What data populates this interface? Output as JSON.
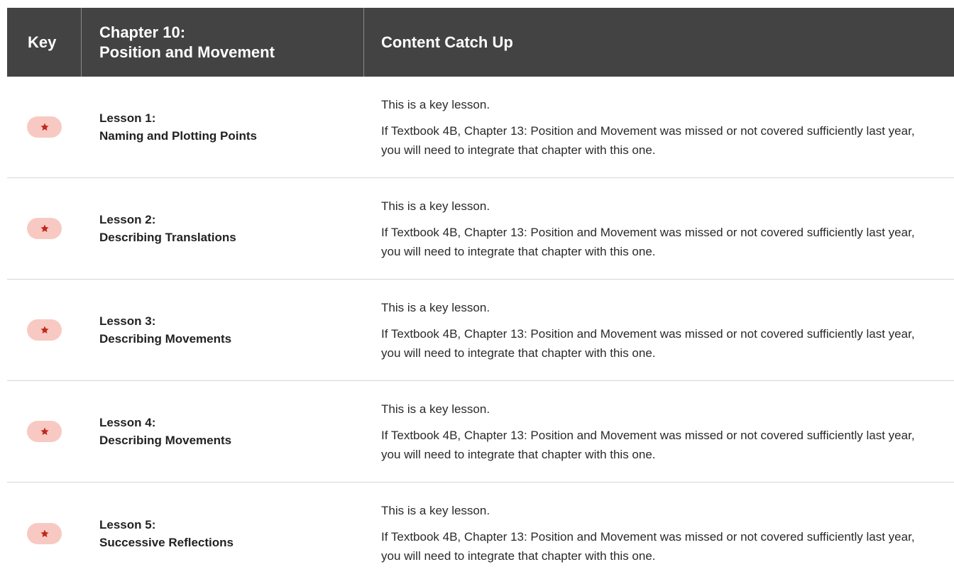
{
  "header": {
    "key": "Key",
    "chapter_line1": "Chapter 10:",
    "chapter_line2": "Position and Movement",
    "content": "Content Catch Up"
  },
  "colors": {
    "header_bg": "#434343",
    "badge_bg": "#f8c9c3",
    "star": "#c0281b"
  },
  "lessons": [
    {
      "number_label": "Lesson 1:",
      "title": "Naming and Plotting Points",
      "key_icon": "star-icon",
      "line1": "This is a key lesson.",
      "line2": "If Textbook 4B, Chapter 13: Position and Movement was missed or not covered sufficiently last year, you will need to integrate that chapter with this one."
    },
    {
      "number_label": "Lesson 2:",
      "title": "Describing Translations",
      "key_icon": "star-icon",
      "line1": "This is a key lesson.",
      "line2": "If Textbook 4B, Chapter 13: Position and Movement was missed or not covered sufficiently last year, you will need to integrate that chapter with this one."
    },
    {
      "number_label": "Lesson 3:",
      "title": "Describing Movements",
      "key_icon": "star-icon",
      "line1": "This is a key lesson.",
      "line2": "If Textbook 4B, Chapter 13: Position and Movement was missed or not covered sufficiently last year, you will need to integrate that chapter with this one."
    },
    {
      "number_label": "Lesson 4:",
      "title": "Describing Movements",
      "key_icon": "star-icon",
      "line1": "This is a key lesson.",
      "line2": "If Textbook 4B, Chapter 13: Position and Movement was missed or not covered sufficiently last year, you will need to integrate that chapter with this one."
    },
    {
      "number_label": "Lesson 5:",
      "title": "Successive Reflections",
      "key_icon": "star-icon",
      "line1": "This is a key lesson.",
      "line2": "If Textbook 4B, Chapter 13: Position and Movement was missed or not covered sufficiently last year, you will need to integrate that chapter with this one."
    }
  ]
}
